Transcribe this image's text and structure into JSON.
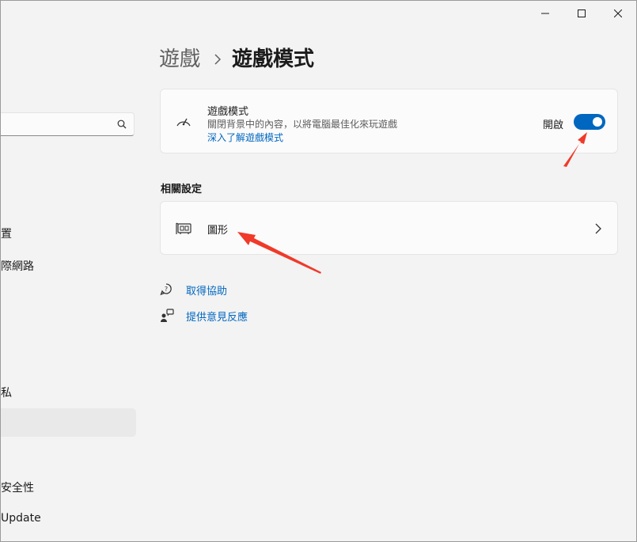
{
  "sidebar": {
    "search_placeholder": "",
    "items": [
      {
        "label": "置"
      },
      {
        "label": "際網路"
      },
      {
        "label": "私"
      },
      {
        "label": "安全性"
      },
      {
        "label": "Update"
      }
    ]
  },
  "header": {
    "breadcrumb_parent": "遊戲",
    "breadcrumb_current": "遊戲模式"
  },
  "game_mode": {
    "title": "遊戲模式",
    "description": "關閉背景中的內容，以將電腦最佳化來玩遊戲",
    "learn_more": "深入了解遊戲模式",
    "toggle_state_label": "開啟",
    "toggle_on": true
  },
  "related": {
    "heading": "相關設定",
    "graphics_label": "圖形"
  },
  "help": {
    "get_help": "取得協助",
    "feedback": "提供意見反應"
  },
  "colors": {
    "accent": "#0067c0",
    "annotation_arrow": "#f03a2a"
  }
}
